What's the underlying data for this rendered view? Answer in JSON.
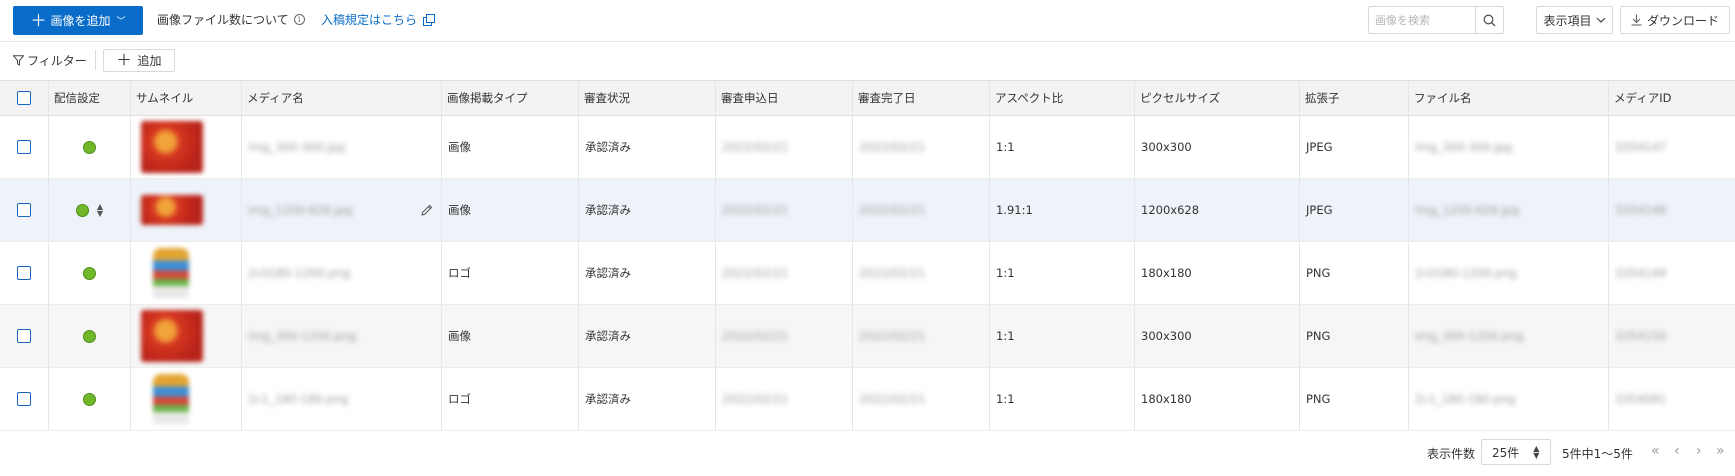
{
  "toolbar": {
    "add_image_label": "画像を追加",
    "image_count_info": "画像ファイル数について",
    "submission_rules_link": "入稿規定はこちら",
    "search_placeholder": "画像を検索",
    "display_items_label": "表示項目",
    "download_label": "ダウンロード"
  },
  "filterbar": {
    "filter_label": "フィルター",
    "add_label": "追加"
  },
  "table": {
    "headers": {
      "delivery": "配信設定",
      "thumbnail": "サムネイル",
      "media_name": "メディア名",
      "placement_type": "画像掲載タイプ",
      "review_status": "審査状況",
      "review_applied": "審査申込日",
      "review_completed": "審査完了日",
      "aspect_ratio": "アスペクト比",
      "pixel_size": "ピクセルサイズ",
      "extension": "拡張子",
      "file_name": "ファイル名",
      "media_id": "メディアID"
    },
    "rows": [
      {
        "media_name": "img_300-300.jpg",
        "type": "画像",
        "status": "承認済み",
        "applied": "2022/02/21",
        "completed": "2022/02/21",
        "aspect": "1:1",
        "pixels": "300x300",
        "ext": "JPEG",
        "file_name": "img_300-300.jpg",
        "media_id": "3354147",
        "delivery_color": "#70b82a",
        "thumb": "red-square"
      },
      {
        "media_name": "img_1200-628.jpg",
        "type": "画像",
        "status": "承認済み",
        "applied": "2022/02/21",
        "completed": "2022/02/21",
        "aspect": "1.91:1",
        "pixels": "1200x628",
        "ext": "JPEG",
        "file_name": "img_1200-628.jpg",
        "media_id": "3354148",
        "delivery_color": "#70b82a",
        "thumb": "red-wide"
      },
      {
        "media_name": "2c0180-1200.png",
        "type": "ロゴ",
        "status": "承認済み",
        "applied": "2022/02/21",
        "completed": "2022/02/21",
        "aspect": "1:1",
        "pixels": "180x180",
        "ext": "PNG",
        "file_name": "2c0180-1200.png",
        "media_id": "3354149",
        "delivery_color": "#70b82a",
        "thumb": "logo"
      },
      {
        "media_name": "img_300-1200.png",
        "type": "画像",
        "status": "承認済み",
        "applied": "2022/02/21",
        "completed": "2022/02/21",
        "aspect": "1:1",
        "pixels": "300x300",
        "ext": "PNG",
        "file_name": "img_300-1200.png",
        "media_id": "3354150",
        "delivery_color": "#70b82a",
        "thumb": "red-square"
      },
      {
        "media_name": "2c1_180-180.png",
        "type": "ロゴ",
        "status": "承認済み",
        "applied": "2022/02/21",
        "completed": "2022/02/21",
        "aspect": "1:1",
        "pixels": "180x180",
        "ext": "PNG",
        "file_name": "2c1_180-180.png",
        "media_id": "3354081",
        "delivery_color": "#70b82a",
        "thumb": "logo"
      }
    ]
  },
  "pager": {
    "per_page_label": "表示件数",
    "per_page_value": "25件",
    "range_text": "5件中1〜5件"
  },
  "colors": {
    "primary": "#0a6cc9",
    "status_green": "#70b82a",
    "checkbox_blue": "#1a66c7"
  }
}
